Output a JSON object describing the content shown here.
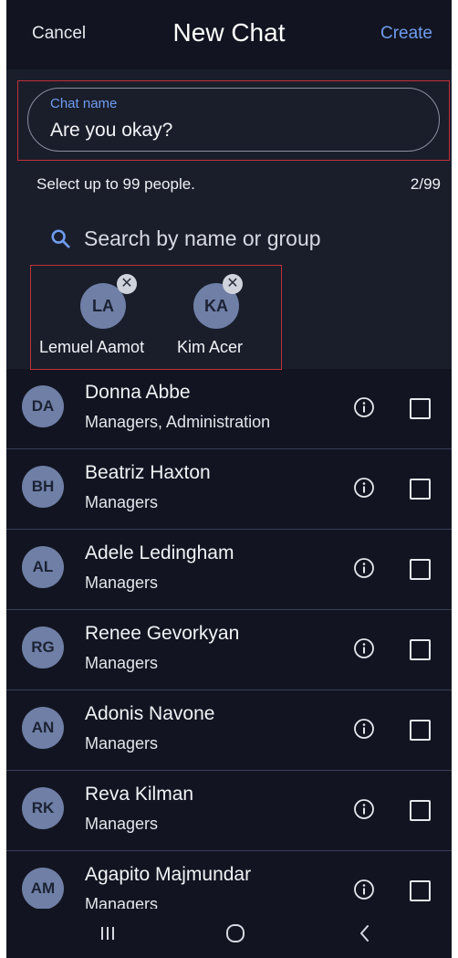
{
  "header": {
    "cancel_label": "Cancel",
    "title": "New Chat",
    "create_label": "Create"
  },
  "chat_name": {
    "label": "Chat name",
    "value": "Are you okay?"
  },
  "selection": {
    "hint": "Select up to 99 people.",
    "count": "2/99"
  },
  "search": {
    "icon": "search-icon",
    "placeholder": "Search by name or group"
  },
  "selected_people": [
    {
      "initials": "LA",
      "name": "Lemuel Aamot",
      "remove_icon": "close-icon"
    },
    {
      "initials": "KA",
      "name": "Kim Acer",
      "remove_icon": "close-icon"
    }
  ],
  "contacts": [
    {
      "initials": "DA",
      "name": "Donna Abbe",
      "group": "Managers, Administration",
      "checked": false
    },
    {
      "initials": "BH",
      "name": "Beatriz Haxton",
      "group": "Managers",
      "checked": false
    },
    {
      "initials": "AL",
      "name": "Adele Ledingham",
      "group": "Managers",
      "checked": false
    },
    {
      "initials": "RG",
      "name": "Renee Gevorkyan",
      "group": "Managers",
      "checked": false
    },
    {
      "initials": "AN",
      "name": "Adonis Navone",
      "group": "Managers",
      "checked": false
    },
    {
      "initials": "RK",
      "name": "Reva Kilman",
      "group": "Managers",
      "checked": false
    },
    {
      "initials": "AM",
      "name": "Agapito Majmundar",
      "group": "Managers",
      "checked": false
    }
  ],
  "nav": {
    "recents_icon": "recent-apps-icon",
    "home_icon": "home-icon",
    "back_icon": "back-icon"
  },
  "colors": {
    "accent": "#6f9cf0",
    "background": "#121521",
    "panel": "#1a1e2b",
    "avatar": "#6f7fa6",
    "highlight": "#c0303a"
  }
}
